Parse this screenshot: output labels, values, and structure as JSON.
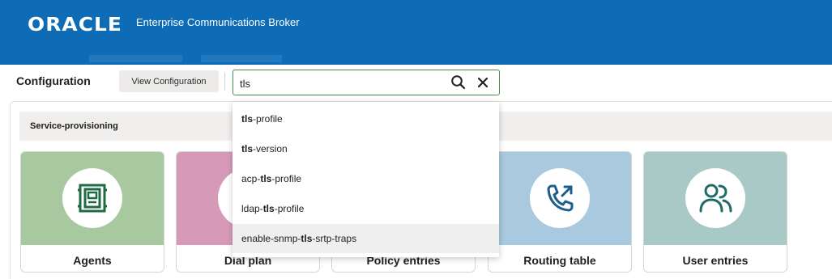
{
  "header": {
    "logo": "ORACLE",
    "product": "Enterprise Communications Broker",
    "background": "#0d6cb5"
  },
  "toolbar": {
    "title": "Configuration",
    "view_button": "View Configuration"
  },
  "search": {
    "value": "tls",
    "search_icon": "search-icon",
    "clear_icon": "close-icon",
    "border_color": "#3f8f4d"
  },
  "dropdown": {
    "options": [
      {
        "pre": "",
        "match": "tls",
        "post": "-profile"
      },
      {
        "pre": "",
        "match": "tls",
        "post": "-version"
      },
      {
        "pre": "acp-",
        "match": "tls",
        "post": "-profile"
      },
      {
        "pre": "ldap-",
        "match": "tls",
        "post": "-profile"
      },
      {
        "pre": "enable-snmp-",
        "match": "tls",
        "post": "-srtp-traps"
      }
    ],
    "highlighted_index": 4
  },
  "section": {
    "label": "Service-provisioning"
  },
  "tiles": [
    {
      "label": "Agents",
      "icon": "agents-icon",
      "color": "#a8c8a0"
    },
    {
      "label": "Dial plan",
      "icon": "dial-plan-icon",
      "color": "#d69ab8"
    },
    {
      "label": "Policy entries",
      "icon": "policy-icon",
      "color": "#c9c0de"
    },
    {
      "label": "Routing table",
      "icon": "phone-outgoing-icon",
      "color": "#a9c9de"
    },
    {
      "label": "User entries",
      "icon": "users-icon",
      "color": "#a8c9c6"
    }
  ]
}
